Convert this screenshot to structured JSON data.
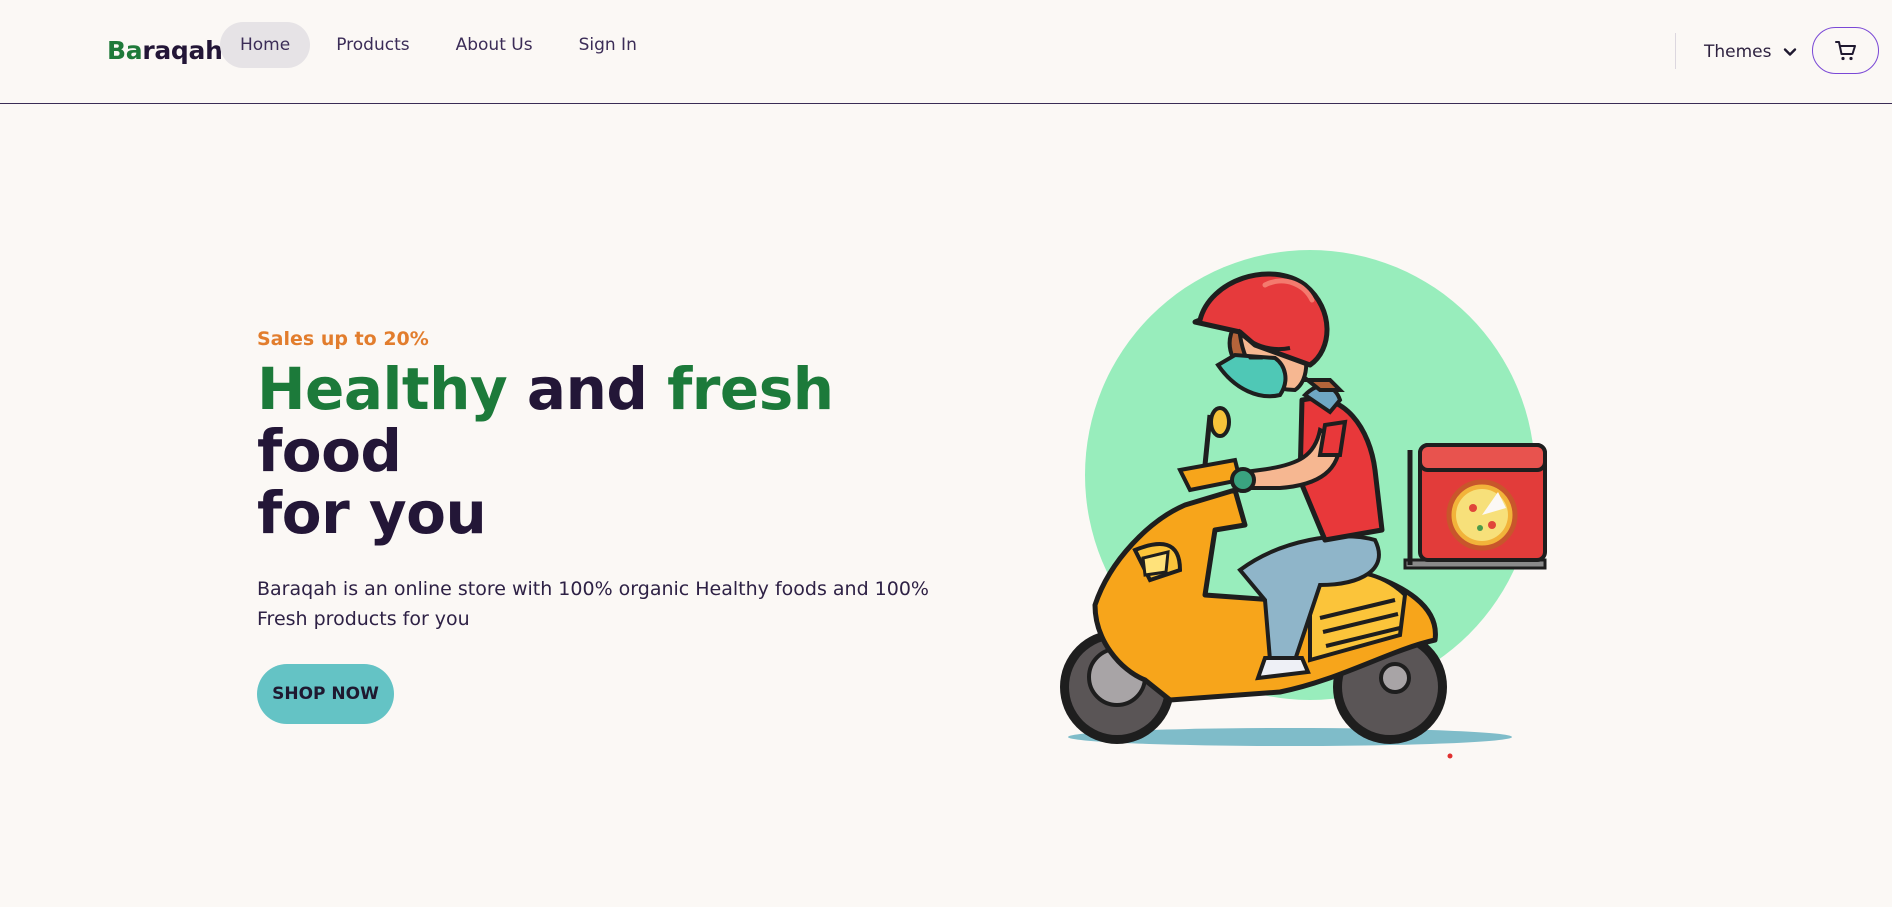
{
  "brand": {
    "name_accent": "Ba",
    "name_rest": "raqah"
  },
  "nav": {
    "items": [
      {
        "label": "Home",
        "active": true
      },
      {
        "label": "Products",
        "active": false
      },
      {
        "label": "About Us",
        "active": false
      },
      {
        "label": "Sign In",
        "active": false
      }
    ],
    "themes_label": "Themes"
  },
  "hero": {
    "sales": "Sales up to 20%",
    "headline": {
      "word1": "Healthy",
      "word2": " and ",
      "word3": "fresh",
      "word4": " food",
      "line2": "for you"
    },
    "description": "Baraqah is an online store with 100% organic Healthy foods and 100% Fresh products for you",
    "cta": "SHOP NOW"
  },
  "colors": {
    "accent_green": "#1c7a3a",
    "sales_orange": "#e27d2d",
    "cta_teal": "#64c3c5",
    "cart_border": "#7a48d6",
    "circle_mint": "#98edbc"
  },
  "icons": {
    "themes_chevron": "chevron-down-icon",
    "cart": "shopping-cart-icon"
  }
}
